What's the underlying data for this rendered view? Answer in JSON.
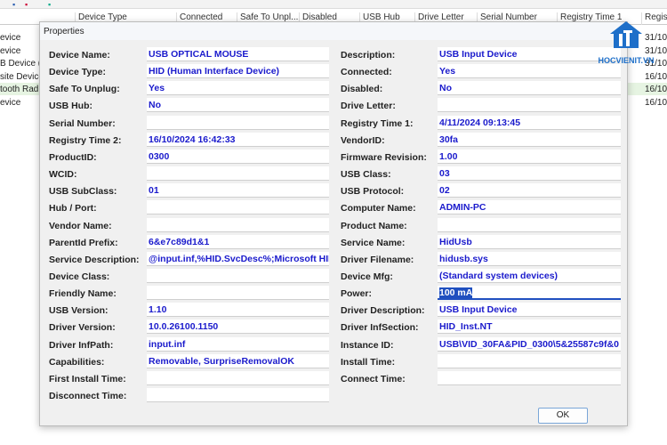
{
  "background": {
    "columns": [
      "Device Type",
      "Connected",
      "Safe To Unpl...",
      "Disabled",
      "USB Hub",
      "Drive Letter",
      "Serial Number",
      "Registry Time 1",
      "Regist"
    ],
    "left_rows": [
      "evice",
      "evice",
      "B Device (D",
      "site Device",
      "tooth Radio",
      "evice"
    ],
    "right_rows": [
      "31/10/",
      "31/10/",
      "31/10/",
      "16/10/",
      "16/10/",
      "16/10/"
    ]
  },
  "dialog": {
    "title": "Properties",
    "left": [
      {
        "label": "Device Name:",
        "value": "USB OPTICAL MOUSE"
      },
      {
        "label": "Device Type:",
        "value": "HID (Human Interface Device)"
      },
      {
        "label": "Safe To Unplug:",
        "value": "Yes"
      },
      {
        "label": "USB Hub:",
        "value": "No"
      },
      {
        "label": "Serial Number:",
        "value": ""
      },
      {
        "label": "Registry Time 2:",
        "value": "16/10/2024 16:42:33"
      },
      {
        "label": "ProductID:",
        "value": "0300"
      },
      {
        "label": "WCID:",
        "value": ""
      },
      {
        "label": "USB SubClass:",
        "value": "01"
      },
      {
        "label": "Hub / Port:",
        "value": ""
      },
      {
        "label": "Vendor Name:",
        "value": ""
      },
      {
        "label": "ParentId Prefix:",
        "value": "6&e7c89d1&1"
      },
      {
        "label": "Service Description:",
        "value": "@input.inf,%HID.SvcDesc%;Microsoft HID"
      },
      {
        "label": "Device Class:",
        "value": ""
      },
      {
        "label": "Friendly Name:",
        "value": ""
      },
      {
        "label": "USB Version:",
        "value": "1.10"
      },
      {
        "label": "Driver Version:",
        "value": "10.0.26100.1150"
      },
      {
        "label": "Driver InfPath:",
        "value": "input.inf"
      },
      {
        "label": "Capabilities:",
        "value": "Removable, SurpriseRemovalOK"
      },
      {
        "label": "First Install Time:",
        "value": ""
      },
      {
        "label": "Disconnect Time:",
        "value": ""
      }
    ],
    "right": [
      {
        "label": "Description:",
        "value": "USB Input Device"
      },
      {
        "label": "Connected:",
        "value": "Yes"
      },
      {
        "label": "Disabled:",
        "value": "No"
      },
      {
        "label": "Drive Letter:",
        "value": ""
      },
      {
        "label": "Registry Time 1:",
        "value": "4/11/2024 09:13:45"
      },
      {
        "label": "VendorID:",
        "value": "30fa"
      },
      {
        "label": "Firmware Revision:",
        "value": "1.00"
      },
      {
        "label": "USB Class:",
        "value": "03"
      },
      {
        "label": "USB Protocol:",
        "value": "02"
      },
      {
        "label": "Computer Name:",
        "value": "ADMIN-PC"
      },
      {
        "label": "Product Name:",
        "value": ""
      },
      {
        "label": "Service Name:",
        "value": "HidUsb"
      },
      {
        "label": "Driver Filename:",
        "value": "hidusb.sys"
      },
      {
        "label": "Device Mfg:",
        "value": "(Standard system devices)"
      },
      {
        "label": "Power:",
        "value": "100 mA"
      },
      {
        "label": "Driver Description:",
        "value": "USB Input Device"
      },
      {
        "label": "Driver InfSection:",
        "value": "HID_Inst.NT"
      },
      {
        "label": "Instance ID:",
        "value": "USB\\VID_30FA&PID_0300\\5&25587c9f&0"
      },
      {
        "label": "Install Time:",
        "value": ""
      },
      {
        "label": "Connect Time:",
        "value": ""
      }
    ],
    "ok_label": "OK",
    "focused_field": "Power:"
  },
  "watermark": "HOCVIENIT.VN"
}
